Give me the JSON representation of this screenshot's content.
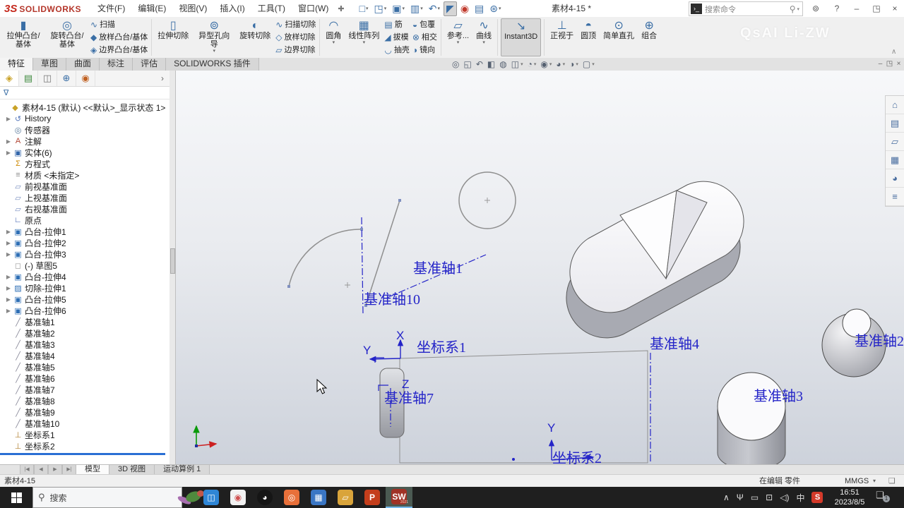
{
  "title_bar": {
    "logo_3s": "3S",
    "logo_text": "SOLIDWORKS",
    "menus": [
      "文件(F)",
      "编辑(E)",
      "视图(V)",
      "插入(I)",
      "工具(T)",
      "窗口(W)"
    ],
    "pin_glyph": "✚",
    "quick_buttons": [
      {
        "name": "new-document-button",
        "glyph": "□",
        "dropdown": true
      },
      {
        "name": "open-document-button",
        "glyph": "◳",
        "dropdown": true
      },
      {
        "name": "save-button",
        "glyph": "▣",
        "dropdown": true
      },
      {
        "name": "print-button",
        "glyph": "▥",
        "dropdown": true
      },
      {
        "name": "undo-button",
        "glyph": "↶",
        "dropdown": true
      },
      {
        "name": "select-cursor-button",
        "glyph": "◤",
        "pressed": true
      },
      {
        "name": "rebuild-button",
        "glyph": "◉",
        "red": true
      },
      {
        "name": "file-properties-button",
        "glyph": "▤"
      },
      {
        "name": "options-button",
        "glyph": "⊛",
        "dropdown": true
      }
    ],
    "doc_title": "素材4-15 *",
    "search": {
      "box_icon": "›_",
      "text": "搜索命令",
      "mag_glyph": "⚲",
      "dd_glyph": "▾"
    },
    "window_controls": {
      "account": "⊚",
      "help": "?",
      "minimize": "–",
      "restore": "◳",
      "close": "×"
    }
  },
  "ribbon": {
    "watermark": "QsAI Li-ZW",
    "collapse_glyph": "∧",
    "groups": [
      {
        "columns": [
          {
            "type": "large",
            "label": "拉伸凸台/基体",
            "glyph": "▮"
          },
          {
            "type": "large",
            "label": "旋转凸台/基体",
            "glyph": "◎"
          },
          {
            "type": "stack",
            "items": [
              {
                "label": "扫描",
                "glyph": "∿"
              },
              {
                "label": "放样凸台/基体",
                "glyph": "◆"
              },
              {
                "label": "边界凸台/基体",
                "glyph": "◈"
              }
            ]
          }
        ]
      },
      {
        "columns": [
          {
            "type": "large",
            "label": "拉伸切除",
            "glyph": "▯"
          },
          {
            "type": "large",
            "label": "异型孔向导",
            "glyph": "⊚",
            "dropdown": true
          },
          {
            "type": "large",
            "label": "旋转切除",
            "glyph": "◐"
          },
          {
            "type": "stack",
            "items": [
              {
                "label": "扫描切除",
                "glyph": "∿"
              },
              {
                "label": "放样切除",
                "glyph": "◇"
              },
              {
                "label": "边界切除",
                "glyph": "▱"
              }
            ]
          }
        ]
      },
      {
        "columns": [
          {
            "type": "large",
            "label": "圆角",
            "glyph": "◠",
            "dropdown": true
          },
          {
            "type": "large",
            "label": "线性阵列",
            "glyph": "▦",
            "dropdown": true
          },
          {
            "type": "stack",
            "items": [
              {
                "label": "筋",
                "glyph": "▤"
              },
              {
                "label": "拔模",
                "glyph": "◢"
              },
              {
                "label": "抽壳",
                "glyph": "◡"
              }
            ]
          },
          {
            "type": "stack",
            "items": [
              {
                "label": "包覆",
                "glyph": "◒"
              },
              {
                "label": "相交",
                "glyph": "⊗"
              },
              {
                "label": "镜向",
                "glyph": "◑"
              }
            ]
          }
        ]
      },
      {
        "columns": [
          {
            "type": "large",
            "label": "参考...",
            "glyph": "▱",
            "dropdown": true
          },
          {
            "type": "large",
            "label": "曲线",
            "glyph": "∿",
            "dropdown": true
          }
        ]
      },
      {
        "columns": [
          {
            "type": "large",
            "label": "Instant3D",
            "glyph": "↘",
            "active": true
          }
        ]
      },
      {
        "columns": [
          {
            "type": "large",
            "label": "正视于",
            "glyph": "⊥"
          },
          {
            "type": "large",
            "label": "圆顶",
            "glyph": "◓"
          },
          {
            "type": "large",
            "label": "简单直孔",
            "glyph": "⊙"
          },
          {
            "type": "large",
            "label": "组合",
            "glyph": "⊕"
          }
        ]
      }
    ]
  },
  "command_tabs": {
    "items": [
      {
        "label": "特征",
        "active": true
      },
      {
        "label": "草图",
        "active": false
      },
      {
        "label": "曲面",
        "active": false
      },
      {
        "label": "标注",
        "active": false
      },
      {
        "label": "评估",
        "active": false
      },
      {
        "label": "SOLIDWORKS 插件",
        "active": false
      }
    ],
    "headsup": [
      {
        "name": "zoom-fit-icon",
        "glyph": "◎"
      },
      {
        "name": "zoom-area-icon",
        "glyph": "◱"
      },
      {
        "name": "previous-view-icon",
        "glyph": "↶"
      },
      {
        "name": "section-view-icon",
        "glyph": "◧"
      },
      {
        "name": "dynamic-annotation-icon",
        "glyph": "◍"
      },
      {
        "name": "view-orientation-icon",
        "glyph": "◫",
        "dropdown": true
      },
      {
        "name": "display-style-icon",
        "glyph": "◔",
        "dropdown": true
      },
      {
        "name": "hide-show-items-icon",
        "glyph": "◉",
        "dropdown": true
      },
      {
        "name": "edit-appearance-icon",
        "glyph": "◕",
        "dropdown": true
      },
      {
        "name": "apply-scene-icon",
        "glyph": "◑",
        "dropdown": true
      },
      {
        "name": "view-settings-icon",
        "glyph": "▢",
        "dropdown": true
      }
    ],
    "child_window_controls": [
      "–",
      "◳",
      "×"
    ]
  },
  "feature_tree": {
    "panel_tabs": [
      {
        "name": "featuremanager-tab",
        "glyph": "◈",
        "color": "#c9a227",
        "active": true
      },
      {
        "name": "propertymanager-tab",
        "glyph": "▤",
        "color": "#3f8a3f"
      },
      {
        "name": "configurationmanager-tab",
        "glyph": "◫",
        "color": "#777777"
      },
      {
        "name": "dimxpertmanager-tab",
        "glyph": "⊕",
        "color": "#3a6ea5"
      },
      {
        "name": "displaymanager-tab",
        "glyph": "◉",
        "color": "#c06020"
      }
    ],
    "more_glyph": "›",
    "filter_glyph": "∇",
    "items": [
      {
        "label": "素材4-15 (默认) <<默认>_显示状态 1>",
        "icon": "part-icon",
        "glyph": "◆",
        "color": "#c9a227",
        "arrow": false,
        "indent": 0
      },
      {
        "label": "History",
        "icon": "history-folder-icon",
        "glyph": "↺",
        "color": "#5577bb",
        "arrow": true,
        "indent": 1
      },
      {
        "label": "传感器",
        "icon": "sensors-icon",
        "glyph": "◎",
        "color": "#557799",
        "arrow": false,
        "indent": 1
      },
      {
        "label": "注解",
        "icon": "annotations-icon",
        "glyph": "A",
        "color": "#b04433",
        "arrow": true,
        "indent": 1
      },
      {
        "label": "实体(6)",
        "icon": "solid-bodies-icon",
        "glyph": "▣",
        "color": "#3366aa",
        "arrow": true,
        "indent": 1
      },
      {
        "label": "方程式",
        "icon": "equations-icon",
        "glyph": "Σ",
        "color": "#cc8800",
        "arrow": false,
        "indent": 1
      },
      {
        "label": "材质 <未指定>",
        "icon": "material-icon",
        "glyph": "≡",
        "color": "#888888",
        "arrow": false,
        "indent": 1
      },
      {
        "label": "前视基准面",
        "icon": "plane-icon",
        "glyph": "▱",
        "color": "#7a8fc0",
        "arrow": false,
        "indent": 1
      },
      {
        "label": "上视基准面",
        "icon": "plane-icon",
        "glyph": "▱",
        "color": "#7a8fc0",
        "arrow": false,
        "indent": 1
      },
      {
        "label": "右视基准面",
        "icon": "plane-icon",
        "glyph": "▱",
        "color": "#7a8fc0",
        "arrow": false,
        "indent": 1
      },
      {
        "label": "原点",
        "icon": "origin-icon",
        "glyph": "∟",
        "color": "#3355aa",
        "arrow": false,
        "indent": 1
      },
      {
        "label": "凸台-拉伸1",
        "icon": "boss-extrude-icon",
        "glyph": "▣",
        "color": "#2f6fb5",
        "arrow": true,
        "indent": 1
      },
      {
        "label": "凸台-拉伸2",
        "icon": "boss-extrude-icon",
        "glyph": "▣",
        "color": "#2f6fb5",
        "arrow": true,
        "indent": 1
      },
      {
        "label": "凸台-拉伸3",
        "icon": "boss-extrude-icon",
        "glyph": "▣",
        "color": "#2f6fb5",
        "arrow": true,
        "indent": 1
      },
      {
        "label": "(-) 草图5",
        "icon": "sketch-icon",
        "glyph": "◻",
        "color": "#999999",
        "arrow": false,
        "indent": 1
      },
      {
        "label": "凸台-拉伸4",
        "icon": "boss-extrude-icon",
        "glyph": "▣",
        "color": "#2f6fb5",
        "arrow": true,
        "indent": 1
      },
      {
        "label": "切除-拉伸1",
        "icon": "cut-extrude-icon",
        "glyph": "▨",
        "color": "#2f6fb5",
        "arrow": true,
        "indent": 1
      },
      {
        "label": "凸台-拉伸5",
        "icon": "boss-extrude-icon",
        "glyph": "▣",
        "color": "#2f6fb5",
        "arrow": true,
        "indent": 1
      },
      {
        "label": "凸台-拉伸6",
        "icon": "boss-extrude-icon",
        "glyph": "▣",
        "color": "#2f6fb5",
        "arrow": true,
        "indent": 1
      },
      {
        "label": "基准轴1",
        "icon": "datum-axis-icon",
        "glyph": "╱",
        "color": "#8a8a9a",
        "arrow": false,
        "indent": 1
      },
      {
        "label": "基准轴2",
        "icon": "datum-axis-icon",
        "glyph": "╱",
        "color": "#8a8a9a",
        "arrow": false,
        "indent": 1
      },
      {
        "label": "基准轴3",
        "icon": "datum-axis-icon",
        "glyph": "╱",
        "color": "#8a8a9a",
        "arrow": false,
        "indent": 1
      },
      {
        "label": "基准轴4",
        "icon": "datum-axis-icon",
        "glyph": "╱",
        "color": "#8a8a9a",
        "arrow": false,
        "indent": 1
      },
      {
        "label": "基准轴5",
        "icon": "datum-axis-icon",
        "glyph": "╱",
        "color": "#8a8a9a",
        "arrow": false,
        "indent": 1
      },
      {
        "label": "基准轴6",
        "icon": "datum-axis-icon",
        "glyph": "╱",
        "color": "#8a8a9a",
        "arrow": false,
        "indent": 1
      },
      {
        "label": "基准轴7",
        "icon": "datum-axis-icon",
        "glyph": "╱",
        "color": "#8a8a9a",
        "arrow": false,
        "indent": 1
      },
      {
        "label": "基准轴8",
        "icon": "datum-axis-icon",
        "glyph": "╱",
        "color": "#8a8a9a",
        "arrow": false,
        "indent": 1
      },
      {
        "label": "基准轴9",
        "icon": "datum-axis-icon",
        "glyph": "╱",
        "color": "#8a8a9a",
        "arrow": false,
        "indent": 1
      },
      {
        "label": "基准轴10",
        "icon": "datum-axis-icon",
        "glyph": "╱",
        "color": "#8a8a9a",
        "arrow": false,
        "indent": 1
      },
      {
        "label": "坐标系1",
        "icon": "coordinate-system-icon",
        "glyph": "⊥",
        "color": "#b08030",
        "arrow": false,
        "indent": 1
      },
      {
        "label": "坐标系2",
        "icon": "coordinate-system-icon",
        "glyph": "⊥",
        "color": "#b08030",
        "arrow": false,
        "indent": 1
      }
    ]
  },
  "task_pane": [
    {
      "name": "home-icon",
      "glyph": "⌂"
    },
    {
      "name": "design-library-icon",
      "glyph": "▤"
    },
    {
      "name": "file-explorer-icon",
      "glyph": "▱"
    },
    {
      "name": "view-palette-icon",
      "glyph": "▦"
    },
    {
      "name": "appearances-scenes-icon",
      "glyph": "◕"
    },
    {
      "name": "custom-properties-icon",
      "glyph": "≡"
    }
  ],
  "viewport": {
    "annotations": {
      "axis1": "基准轴1",
      "axis10": "基准轴10",
      "axis7": "基准轴7",
      "axis4": "基准轴4",
      "axis3": "基准轴3",
      "axis2": "基准轴2",
      "csys1": "坐标系1",
      "csys2": "坐标系2",
      "csys1_x": "X",
      "csys1_y": "Y",
      "csys1_z": "Z",
      "csys2_y": "Y"
    },
    "annotation_color": "#2424c8"
  },
  "doc_tabs": {
    "nav_glyphs": [
      "|◀",
      "◀",
      "▶",
      "▶|"
    ],
    "items": [
      {
        "label": "模型",
        "active": true
      },
      {
        "label": "3D 视图",
        "active": false
      },
      {
        "label": "运动算例 1",
        "active": false
      }
    ]
  },
  "status_bar": {
    "document": "素材4-15",
    "mode": "在编辑 零件",
    "units": "MMGS",
    "units_dd": "▾",
    "tag_glyph": "❏"
  },
  "taskbar": {
    "search_text": "搜索",
    "search_mag": "⚲",
    "apps": [
      {
        "name": "mail-app-icon",
        "glyph": "◫",
        "fg": "#ffffff",
        "bg": "#2f86d6"
      },
      {
        "name": "pc-manager-app-icon",
        "glyph": "◉",
        "fg": "#d05050",
        "bg": "#f2f2f2"
      },
      {
        "name": "qq-app-icon",
        "glyph": "◕",
        "fg": "#ffffff",
        "bg": "#151515"
      },
      {
        "name": "browser-app-icon",
        "glyph": "◎",
        "fg": "#ffffff",
        "bg": "#e8703a"
      },
      {
        "name": "calculator-app-icon",
        "glyph": "▦",
        "fg": "#ffffff",
        "bg": "#3a76c4"
      },
      {
        "name": "file-explorer-app-icon",
        "glyph": "▱",
        "fg": "#ffffff",
        "bg": "#d9a43b"
      },
      {
        "name": "powerpoint-app-icon",
        "glyph": "P",
        "fg": "#ffffff",
        "bg": "#c43e1c"
      },
      {
        "name": "solidworks-app-icon",
        "glyph": "SW",
        "fg": "#ffffff",
        "bg": "#a03226",
        "sub": "2021",
        "active": true
      }
    ],
    "tray": [
      {
        "name": "tray-expand-icon",
        "glyph": "∧"
      },
      {
        "name": "microphone-icon",
        "glyph": "Ψ"
      },
      {
        "name": "projector-icon",
        "glyph": "▭"
      },
      {
        "name": "display-icon",
        "glyph": "⊡"
      },
      {
        "name": "volume-icon",
        "glyph": "◁)"
      },
      {
        "name": "ime-icon",
        "glyph": "中"
      },
      {
        "name": "sogou-icon",
        "glyph": "S",
        "sogou": true
      }
    ],
    "time": "16:51",
    "date": "2023/8/5",
    "notification_glyph": "❏",
    "notification_badge": "1"
  }
}
